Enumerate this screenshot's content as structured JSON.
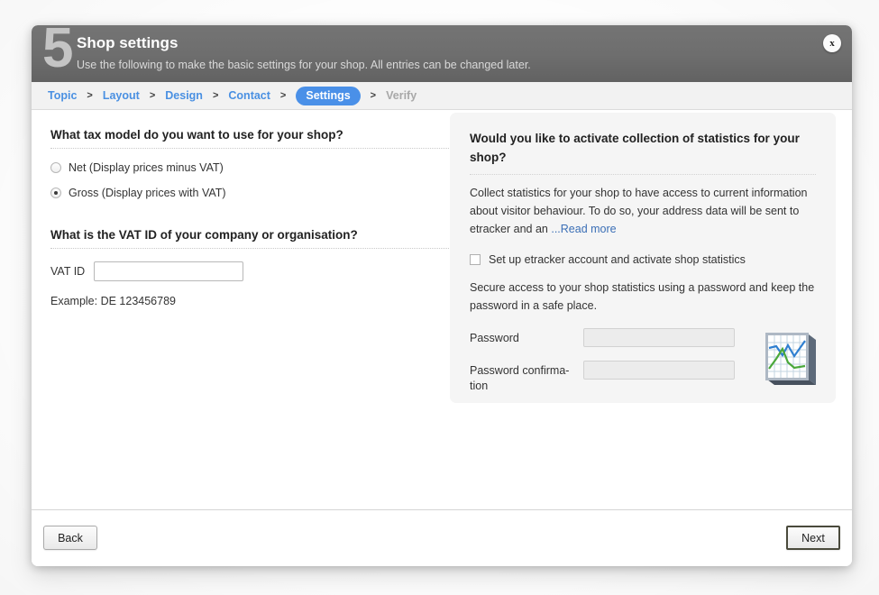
{
  "dialog": {
    "step_number": "5",
    "title": "Shop settings",
    "subtitle": "Use the following to make the basic settings for your shop. All entries can be changed later.",
    "close_label": "x",
    "accent_color": "#4a90e8",
    "header_bg": "#6e6e6e",
    "panel_bg": "#f5f5f5"
  },
  "breadcrumb": {
    "separator": ">",
    "items": [
      {
        "label": "Topic",
        "state": "link"
      },
      {
        "label": "Layout",
        "state": "link"
      },
      {
        "label": "Design",
        "state": "link"
      },
      {
        "label": "Contact",
        "state": "link"
      },
      {
        "label": "Settings",
        "state": "active"
      },
      {
        "label": "Verify",
        "state": "disabled"
      }
    ]
  },
  "tax_section": {
    "heading": "What tax model do you want to use for your shop?",
    "options": [
      {
        "label": "Net (Display prices minus VAT)",
        "checked": false
      },
      {
        "label": "Gross (Display prices with VAT)",
        "checked": true
      }
    ]
  },
  "vat_section": {
    "heading": "What is the VAT ID of your company or organisation?",
    "field_label": "VAT ID",
    "field_value": "",
    "field_placeholder": "",
    "example": "Example: DE 123456789"
  },
  "statistics_panel": {
    "heading": "Would you like to activate collection of statistics for your shop?",
    "description": "Collect statistics for your shop to have access to current information about visitor behaviour. To do so, your address data will be sent to etracker and an",
    "read_more": "...Read more",
    "checkbox_label": "Set up etracker account and activate shop statistics",
    "checkbox_checked": false,
    "password_note": "Secure access to your shop statistics using a password and keep the password in a safe place.",
    "password_label": "Password",
    "password_value": "",
    "password_confirm_label": "Password confirma-tion",
    "password_confirm_value": "",
    "icon_name": "statistics-chart-icon"
  },
  "footer": {
    "back_label": "Back",
    "next_label": "Next"
  }
}
